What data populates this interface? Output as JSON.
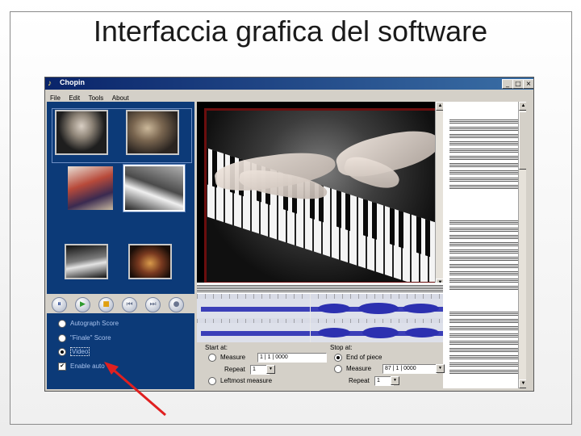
{
  "slide": {
    "title": "Interfaccia grafica del software"
  },
  "window": {
    "title": "Chopin",
    "icon": "chopin-app-icon",
    "controls": {
      "minimize": "_",
      "maximize": "□",
      "close": "×"
    }
  },
  "menu": {
    "items": [
      "File",
      "Edit",
      "Tools",
      "About"
    ]
  },
  "thumbnails": [
    {
      "name": "portrait-chopin-thumb",
      "selected": false
    },
    {
      "name": "chopin-at-piano-thumb",
      "selected": false
    },
    {
      "name": "painting-thumb",
      "selected": false
    },
    {
      "name": "hands-on-piano-thumb",
      "selected": true
    },
    {
      "name": "pianist-hands-thumb",
      "selected": false
    },
    {
      "name": "concert-hall-thumb",
      "selected": false
    }
  ],
  "transport": {
    "buttons": [
      {
        "name": "pause-button",
        "glyph": "⏸",
        "color": "#1f3f8f"
      },
      {
        "name": "play-button",
        "glyph": "▶",
        "color": "#2e9a2e"
      },
      {
        "name": "stop-button",
        "glyph": "■",
        "color": "#e0a010"
      },
      {
        "name": "rewind-button",
        "glyph": "⏮",
        "color": "#6b7690"
      },
      {
        "name": "fast-forward-button",
        "glyph": "⏭",
        "color": "#6b7690"
      },
      {
        "name": "record-button",
        "glyph": "●",
        "color": "#6b7690"
      }
    ]
  },
  "view_options": {
    "autograph_score": "Autograph Score",
    "finale_score": "\"Finale\" Score",
    "video": "Video",
    "enable": "Enable auto",
    "selected": "video",
    "enable_checked": true
  },
  "playback": {
    "start_label": "Start at:",
    "stop_label": "Stop at:",
    "start_measure_label": "Measure",
    "start_measure_value": "1 | 1 | 0000",
    "start_repeat_label": "Repeat",
    "start_repeat_value": "1",
    "leftmost_label": "Leftmost measure",
    "end_of_piece_label": "End of piece",
    "stop_measure_label": "Measure",
    "stop_measure_value": "87 | 1 | 0000",
    "stop_repeat_label": "Repeat",
    "stop_repeat_value": "1",
    "stop_selected": "end_of_piece"
  },
  "annotation": {
    "arrow_color": "#e02020",
    "points_to": "video-radio"
  },
  "colors": {
    "panel_blue": "#0c3a78",
    "window_gray": "#d4d0c8",
    "video_border": "#6b0e0e",
    "waveform": "#3b3fb8"
  }
}
